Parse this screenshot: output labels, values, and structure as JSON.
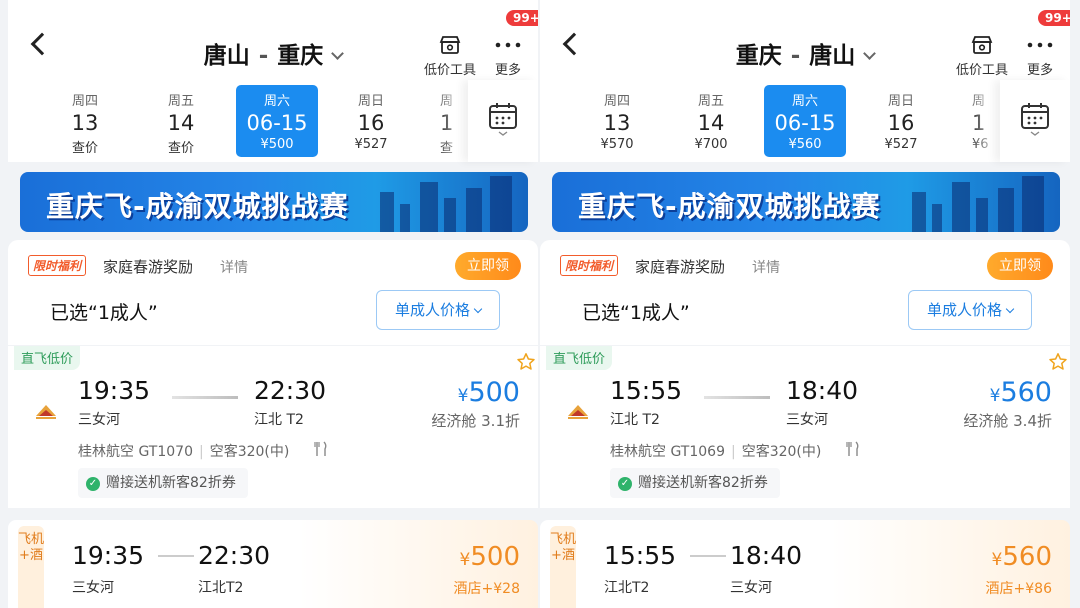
{
  "common": {
    "low_price_tool": "低价工具",
    "more": "更多",
    "more_badge": "99+",
    "currency": "¥",
    "banner_text": "重庆飞-成渝双城挑战赛",
    "promo_tag": "限时福利",
    "promo_title": "家庭春游奖励",
    "promo_detail": "详情",
    "claim_button": "立即领",
    "selected_passengers": "已选“1成人”",
    "price_type": "单成人价格",
    "direct_tag": "直飞低价",
    "coupon": "赠接送机新客82折券",
    "pkg_side_label": "飞机+酒",
    "colors": {
      "accent": "#1b8cf0",
      "price_blue": "#1b7de0",
      "orange": "#f08c24",
      "badge_red": "#ee3b3b"
    }
  },
  "panels": [
    {
      "origin": "唐山",
      "destination": "重庆",
      "dates": [
        {
          "weekday": "周四",
          "day": "13",
          "price": "查价"
        },
        {
          "weekday": "周五",
          "day": "14",
          "price": "查价"
        },
        {
          "weekday": "周六",
          "day": "06-15",
          "price": "¥500",
          "selected": true
        },
        {
          "weekday": "周日",
          "day": "16",
          "price": "¥527"
        },
        {
          "weekday": "周",
          "day": "1",
          "price": "查"
        }
      ],
      "flight": {
        "dep_time": "19:35",
        "dep_airport": "三女河",
        "arr_time": "22:30",
        "arr_airport": "江北 T2",
        "price": "500",
        "cabin": "经济舱 3.1折",
        "airline": "桂林航空 GT1070",
        "aircraft": "空客320(中)"
      },
      "package": {
        "dep_time": "19:35",
        "dep_airport": "三女河",
        "arr_time": "22:30",
        "arr_airport": "江北T2",
        "price": "500",
        "hotel_extra": "酒店+¥28"
      }
    },
    {
      "origin": "重庆",
      "destination": "唐山",
      "dates": [
        {
          "weekday": "周四",
          "day": "13",
          "price": "¥570"
        },
        {
          "weekday": "周五",
          "day": "14",
          "price": "¥700"
        },
        {
          "weekday": "周六",
          "day": "06-15",
          "price": "¥560",
          "selected": true
        },
        {
          "weekday": "周日",
          "day": "16",
          "price": "¥527"
        },
        {
          "weekday": "周",
          "day": "1",
          "price": "¥6"
        }
      ],
      "flight": {
        "dep_time": "15:55",
        "dep_airport": "江北 T2",
        "arr_time": "18:40",
        "arr_airport": "三女河",
        "price": "560",
        "cabin": "经济舱 3.4折",
        "airline": "桂林航空 GT1069",
        "aircraft": "空客320(中)"
      },
      "package": {
        "dep_time": "15:55",
        "dep_airport": "江北T2",
        "arr_time": "18:40",
        "arr_airport": "三女河",
        "price": "560",
        "hotel_extra": "酒店+¥86"
      }
    }
  ]
}
